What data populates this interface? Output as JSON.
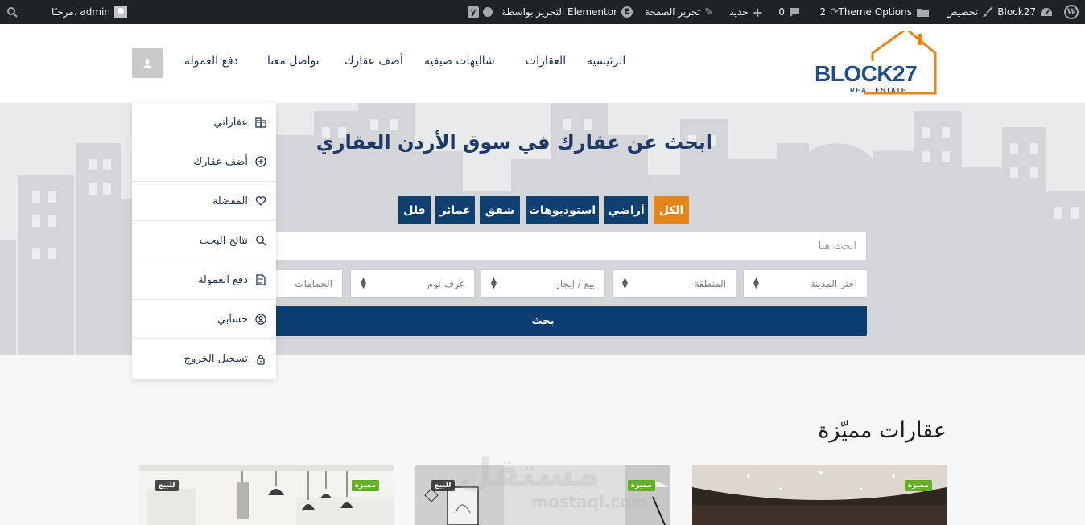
{
  "adminbar": {
    "site_name": "Block27",
    "customize": "تخصيص",
    "theme_options": "Theme Options",
    "updates_count": "2",
    "comments_count": "0",
    "new": "جديد",
    "edit_page": "تحرير الصفحة",
    "elementor": "التحرير بواسطة Elementor",
    "greeting": "مرحبًا، admin"
  },
  "header": {
    "logo": "BLOCK27",
    "logo_sub": "REAL ESTATE",
    "nav": [
      "الرئيسية",
      "العقارات",
      "شاليهات صيفية",
      "أضف عقارك",
      "تواصل معنا",
      "دفع العمولة"
    ]
  },
  "hero": {
    "title": "ابحث عن عقارك في سوق الأردن العقاري",
    "tabs": [
      "الكل",
      "أراضي",
      "استوديوهات",
      "شقق",
      "عمائر",
      "فلل"
    ],
    "search_placeholder": "ابحث هنا",
    "selects": [
      "اختر المدينة",
      "المنطقة",
      "بيع / إيجار",
      "غرف نوم",
      "الحمامات"
    ],
    "search_button": "بحث"
  },
  "dropdown": [
    {
      "label": "عقاراتي",
      "icon": "building-icon"
    },
    {
      "label": "أضف عقارك",
      "icon": "plus-circle-icon"
    },
    {
      "label": "المفضلة",
      "icon": "heart-icon"
    },
    {
      "label": "نتائج البحث",
      "icon": "search-icon"
    },
    {
      "label": "دفع العمولة",
      "icon": "invoice-icon"
    },
    {
      "label": "حسابي",
      "icon": "user-circle-icon"
    },
    {
      "label": "تسجيل الخروج",
      "icon": "lock-icon"
    }
  ],
  "featured": {
    "title": "عقارات مميّزة",
    "cards": [
      {
        "featured": "مميزة",
        "status": "للبيع"
      },
      {
        "featured": "مميزة",
        "status": "للبيع"
      },
      {
        "featured": "مميزة",
        "status": ""
      }
    ]
  },
  "watermark": {
    "main": "مستقل",
    "sub": "mostaql.com"
  },
  "colors": {
    "primary": "#0b3d72",
    "accent": "#e5861a",
    "adminbar": "#1d2327",
    "featured_badge": "#64b023"
  }
}
